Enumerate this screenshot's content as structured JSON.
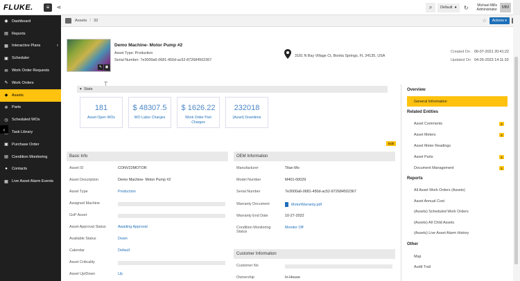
{
  "topbar": {
    "logo": "FLUKE.",
    "default_label": "Default",
    "user_name": "Michael Mills",
    "user_role": "Administrator",
    "avatar": "MM"
  },
  "sidebar": {
    "items": [
      {
        "label": "Dashboard",
        "icon": "dashboard-icon",
        "glyph": "◉"
      },
      {
        "label": "Reports",
        "icon": "reports-icon",
        "glyph": "▤"
      },
      {
        "label": "Interactive Plans",
        "icon": "plans-icon",
        "glyph": "▦",
        "chevron": "›"
      },
      {
        "label": "Scheduler",
        "icon": "scheduler-icon",
        "glyph": "▣"
      },
      {
        "label": "Work Order Requests",
        "icon": "requests-icon",
        "glyph": "✉"
      },
      {
        "label": "Work Orders",
        "icon": "wrench-icon",
        "glyph": "✎"
      },
      {
        "label": "Assets",
        "icon": "box-icon",
        "glyph": "◆"
      },
      {
        "label": "Parts",
        "icon": "gear-icon",
        "glyph": "✲"
      },
      {
        "label": "Scheduled WOs",
        "icon": "calendar-icon",
        "glyph": "◷"
      },
      {
        "label": "Task Library",
        "icon": "book-icon",
        "glyph": "▤"
      },
      {
        "label": "Purchase Order",
        "icon": "cart-icon",
        "glyph": "▣"
      },
      {
        "label": "Condition Monitoring",
        "icon": "monitor-icon",
        "glyph": "▤"
      },
      {
        "label": "Contacts",
        "icon": "contacts-icon",
        "glyph": "●"
      },
      {
        "label": "Live Asset Alarm Events",
        "icon": "alarm-icon",
        "glyph": "▦"
      }
    ],
    "toggle": "‹"
  },
  "breadcrumb": {
    "section": "Assets",
    "separator": "/",
    "id": "32",
    "actions_label": "Actions ▾",
    "star": "☆"
  },
  "asset": {
    "name": "Demo Machine- Motor Pump #2",
    "type_line": "Asset Type: Production",
    "serial_line": "Serial Number: 7e3000a6-0681-450d-ac52-872684502367",
    "address": "3181 N Bay Village Ct, Bonita Springs, FL 34135, USA",
    "created_label": "Created On",
    "created_value": "06-07-2021 20:41:22",
    "updated_label": "Updated On",
    "updated_value": "04-26-2023 14:11:33"
  },
  "stats": {
    "title": "Stats",
    "caret": "▾",
    "cards": [
      {
        "value": "181",
        "label": "Asset Open WOs"
      },
      {
        "value": "$ 48307.5",
        "label": "WO Labor Charges"
      },
      {
        "value": "$ 1626.22",
        "label": "Work Order Part Charges"
      },
      {
        "value": "232018",
        "label": "(Asset) Downtime"
      }
    ],
    "edit_label": "Edit"
  },
  "basic_info": {
    "title": "Basic Info",
    "rows": [
      {
        "label": "Asset ID",
        "value": "CONV22MOTOR",
        "kind": "text"
      },
      {
        "label": "Asset Description",
        "value": "Demo Machine- Motor Pump #2",
        "kind": "text"
      },
      {
        "label": "Asset Type",
        "value": "Production",
        "kind": "link"
      },
      {
        "label": "Assigned Machine",
        "value": "",
        "kind": "empty"
      },
      {
        "label": "GxP Asset",
        "value": "",
        "kind": "empty"
      },
      {
        "label": "Asset Approval Status",
        "value": "Awaiting Approval",
        "kind": "link"
      },
      {
        "label": "Available Status",
        "value": "Down",
        "kind": "link"
      },
      {
        "label": "Calendar",
        "value": "Default",
        "kind": "link"
      },
      {
        "label": "Asset Criticality",
        "value": "",
        "kind": "empty"
      },
      {
        "label": "Asset Up/Down",
        "value": "Up",
        "kind": "link"
      }
    ]
  },
  "oem_info": {
    "title": "OEM Information",
    "rows": [
      {
        "label": "Manufacturer",
        "value": "Titan Mo",
        "kind": "text"
      },
      {
        "label": "Model Number",
        "value": "M401-00029",
        "kind": "text"
      },
      {
        "label": "Serial Number",
        "value": "7e3000a6-0681-450d-ac52-872684502367",
        "kind": "text"
      },
      {
        "label": "Warranty Document",
        "value": "MotorWarranty.pdf",
        "kind": "file"
      },
      {
        "label": "Warranty End Date",
        "value": "10-27-2022",
        "kind": "text"
      },
      {
        "label": "Condition Monitoring Status",
        "value": "Monitor Off",
        "kind": "link"
      }
    ]
  },
  "customer_info": {
    "title": "Customer Information",
    "rows": [
      {
        "label": "Customer No",
        "value": "",
        "kind": "empty"
      },
      {
        "label": "Ownership",
        "value": "In-House",
        "kind": "text"
      }
    ]
  },
  "right_panel": {
    "overview_title": "Overview",
    "general_info": "General Information",
    "related_title": "Related Entities",
    "related_items": [
      {
        "label": "Asset Comments",
        "badge": "2"
      },
      {
        "label": "Asset Meters",
        "badge": "4"
      },
      {
        "label": "Asset Meter Readings",
        "badge": ""
      },
      {
        "label": "Asset Parts",
        "badge": "4"
      },
      {
        "label": "Document Management",
        "badge": "2"
      }
    ],
    "reports_title": "Reports",
    "report_items": [
      "All Asset Work Orders (Assets)",
      "Asset Annual Cost",
      "(Assets) Scheduled Work Orders",
      "(Assets) All Child Assets",
      "(Assets) Live Asset Alarm History"
    ],
    "other_title": "Other",
    "other_items": [
      "Map",
      "Audit Trail"
    ]
  }
}
